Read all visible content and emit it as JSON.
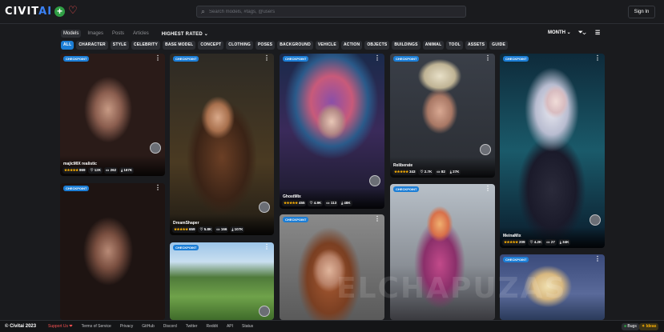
{
  "header": {
    "logo_main": "CIVIT",
    "logo_accent": "AI",
    "search_placeholder": "Search models, #tags, @users",
    "signin_label": "Sign In"
  },
  "tabs": [
    {
      "label": "Models",
      "active": true
    },
    {
      "label": "Images",
      "active": false
    },
    {
      "label": "Posts",
      "active": false
    },
    {
      "label": "Articles",
      "active": false
    }
  ],
  "sort_label": "HIGHEST RATED",
  "period_label": "MONTH",
  "categories": [
    "ALL",
    "CHARACTER",
    "STYLE",
    "CELEBRITY",
    "BASE MODEL",
    "CONCEPT",
    "CLOTHING",
    "POSES",
    "BACKGROUND",
    "VEHICLE",
    "ACTION",
    "OBJECTS",
    "BUILDINGS",
    "ANIMAL",
    "TOOL",
    "ASSETS",
    "GUIDE"
  ],
  "badge_label": "CHECKPOINT",
  "cards": [
    {
      "name": "majicMIX realistic",
      "stars": "★★★★★",
      "rating": "869",
      "likes": "12K",
      "comments": "262",
      "downloads": "167K"
    },
    {
      "name": "",
      "stars": "",
      "rating": "",
      "likes": "",
      "comments": "",
      "downloads": ""
    },
    {
      "name": "DreamShaper",
      "stars": "★★★★★",
      "rating": "659",
      "likes": "5.8K",
      "comments": "166",
      "downloads": "107K"
    },
    {
      "name": "",
      "stars": "",
      "rating": "",
      "likes": "",
      "comments": "",
      "downloads": ""
    },
    {
      "name": "GhostMix",
      "stars": "★★★★★",
      "rating": "455",
      "likes": "4.9K",
      "comments": "113",
      "downloads": "48K"
    },
    {
      "name": "",
      "stars": "",
      "rating": "",
      "likes": "",
      "comments": "",
      "downloads": ""
    },
    {
      "name": "Reliberate",
      "stars": "★★★★★",
      "rating": "343",
      "likes": "2.7K",
      "comments": "82",
      "downloads": "27K"
    },
    {
      "name": "",
      "stars": "",
      "rating": "",
      "likes": "",
      "comments": "",
      "downloads": ""
    },
    {
      "name": "MeinaMix",
      "stars": "★★★★★",
      "rating": "209",
      "likes": "4.2K",
      "comments": "27",
      "downloads": "34K"
    },
    {
      "name": "",
      "stars": "",
      "rating": "",
      "likes": "",
      "comments": "",
      "downloads": ""
    }
  ],
  "footer": {
    "copyright": "© Civitai 2023",
    "links": [
      "Support Us ❤",
      "Terms of Service",
      "Privacy",
      "GitHub",
      "Discord",
      "Twitter",
      "Reddit",
      "API",
      "Status"
    ],
    "bugs": "Bugs",
    "ideas": "Ideas"
  },
  "watermark": "ELCHAPUZAS"
}
